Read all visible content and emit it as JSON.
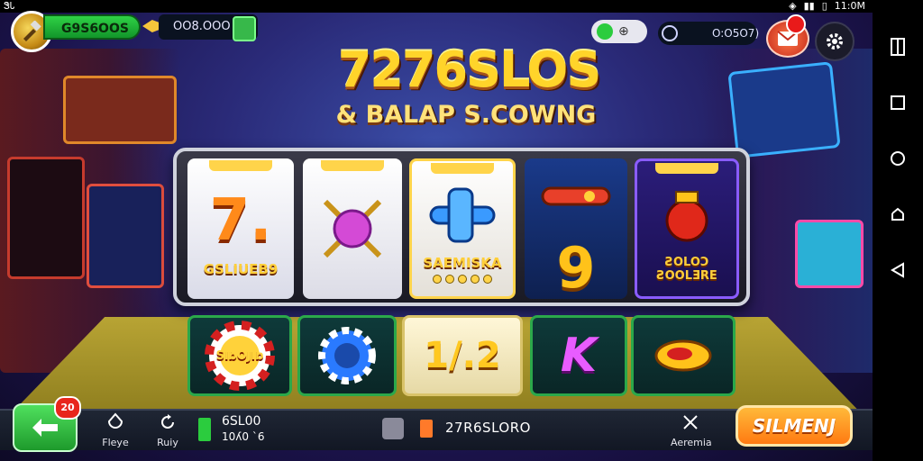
{
  "status_bar": {
    "left": "ᏕᏓ",
    "time": "11:0M"
  },
  "hud": {
    "coins": "G9S6OOS",
    "gems": "OO8.OOO",
    "timer": "O:O5O7)"
  },
  "title": {
    "main": "7276SLOS",
    "sub": "& BALAP S.COWNG"
  },
  "reels": [
    {
      "tag": "",
      "label": "GSLIUEB9",
      "symbol": "7."
    },
    {
      "tag": "",
      "label": "",
      "symbol": ""
    },
    {
      "tag": "",
      "label": "SAEMISKA",
      "symbol": ""
    },
    {
      "tag": "",
      "label": "",
      "symbol": "9"
    },
    {
      "tag": "",
      "label": "ƧOLOƆ\nƧOOLƎRE",
      "symbol": ""
    }
  ],
  "bottom_tiles": {
    "chip_label": "SlbOJlb",
    "center_value": "1/.2",
    "k_label": "K"
  },
  "bottom_bar": {
    "back_badge": "20",
    "items": [
      {
        "label": "Fleye"
      },
      {
        "label": "Ruiy"
      },
      {
        "label": "Aeremia"
      }
    ],
    "stat_a": "6SL00",
    "stat_b": "10ʎ0 ˋ6",
    "wallet": "27R6SLORO",
    "spin": "SILMENJ"
  }
}
